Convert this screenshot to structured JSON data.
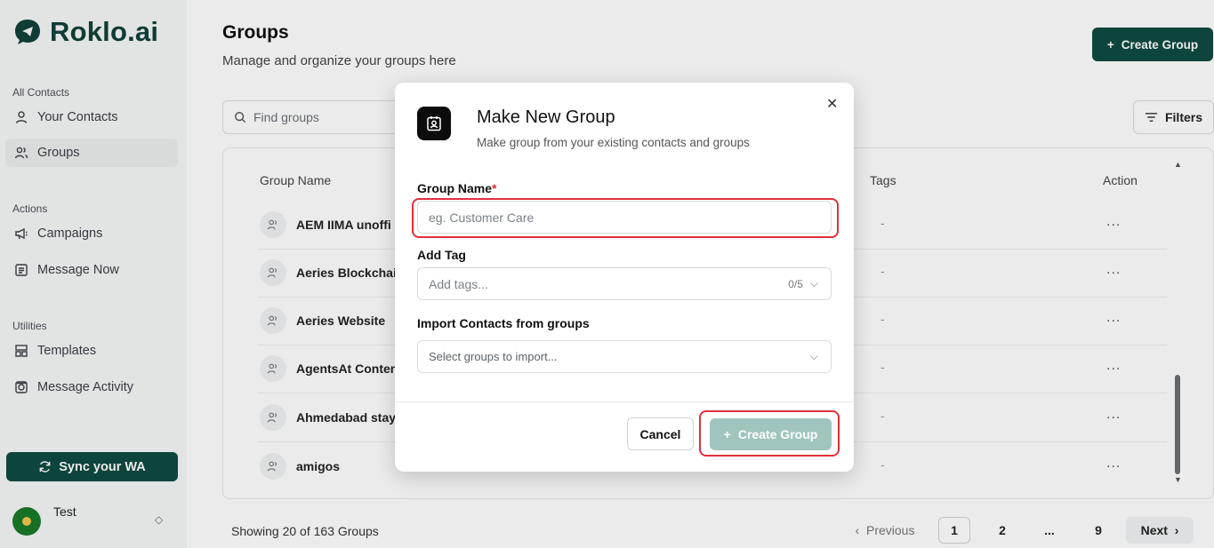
{
  "brand": {
    "name": "Roklo.ai"
  },
  "sidebar": {
    "sections": [
      {
        "label": "All Contacts"
      },
      {
        "label": "Actions"
      },
      {
        "label": "Utilities"
      }
    ],
    "items": [
      {
        "label": "Your Contacts",
        "icon": "user-icon"
      },
      {
        "label": "Groups",
        "icon": "users-icon",
        "active": true
      },
      {
        "label": "Campaigns",
        "icon": "megaphone-icon"
      },
      {
        "label": "Message Now",
        "icon": "message-icon"
      },
      {
        "label": "Templates",
        "icon": "template-icon"
      },
      {
        "label": "Message Activity",
        "icon": "activity-icon"
      }
    ],
    "sync_label": "Sync your WA",
    "user": {
      "name": "Test"
    }
  },
  "header": {
    "title": "Groups",
    "subtitle": "Manage and organize your groups here",
    "create_label": "Create Group"
  },
  "search": {
    "placeholder": "Find groups"
  },
  "filters_label": "Filters",
  "table": {
    "columns": [
      "Group Name",
      "Tags",
      "Action"
    ],
    "rows": [
      {
        "name": "AEM IIMA unoffi",
        "tags": "-",
        "action": "..."
      },
      {
        "name": "Aeries Blockchair",
        "tags": "-",
        "action": "..."
      },
      {
        "name": "Aeries Website",
        "tags": "-",
        "action": "..."
      },
      {
        "name": "AgentsAt Conten",
        "tags": "-",
        "action": "..."
      },
      {
        "name": "Ahmedabad stay",
        "tags": "-",
        "action": "..."
      },
      {
        "name": "amigos",
        "tags": "-",
        "action": "..."
      }
    ]
  },
  "footer": {
    "count_text": "Showing 20 of 163 Groups",
    "pagination": {
      "prev": "Previous",
      "pages": [
        "1",
        "2",
        "...",
        "9"
      ],
      "next": "Next"
    }
  },
  "modal": {
    "title": "Make New Group",
    "subtitle": "Make group from your existing contacts and groups",
    "group_name": {
      "label": "Group Name",
      "required_mark": "*",
      "placeholder": "eg. Customer Care",
      "value": ""
    },
    "tags": {
      "label": "Add Tag",
      "placeholder": "Add tags...",
      "counter": "0/5"
    },
    "import": {
      "label": "Import Contacts from groups",
      "placeholder": "Select groups to import..."
    },
    "cancel_label": "Cancel",
    "create_label": "Create Group"
  },
  "colors": {
    "brand": "#0f4a40",
    "highlight": "#e0303b",
    "disabled_button": "#9fc5be"
  }
}
